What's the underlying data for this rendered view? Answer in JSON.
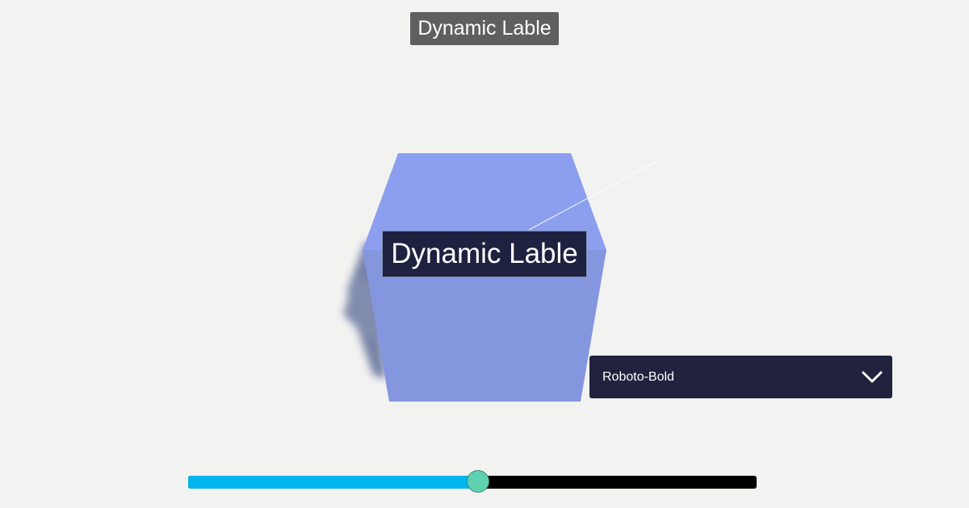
{
  "top_label": {
    "text": "Dynamic Lable"
  },
  "scene": {
    "cube_label": "Dynamic Lable",
    "cube_color_top": "#8c9fee",
    "cube_color_front": "#8496de"
  },
  "font_dropdown": {
    "selected": "Roboto-Bold"
  },
  "size_slider": {
    "value_fraction": 0.51,
    "fill_color": "#00b4ec",
    "track_color": "#000000",
    "thumb_color": "#5ed1b1"
  }
}
